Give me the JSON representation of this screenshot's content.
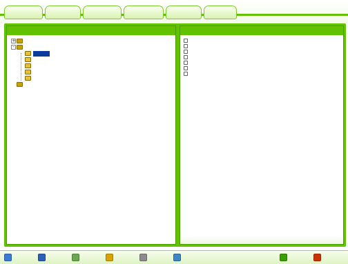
{
  "tabs": [
    {
      "label": ""
    },
    {
      "label": ""
    },
    {
      "label": ""
    },
    {
      "label": ""
    },
    {
      "label": ""
    },
    {
      "label": ""
    }
  ],
  "left_pane": {
    "title": "",
    "tree": [
      {
        "label": "",
        "level": 1,
        "expander": "+"
      },
      {
        "label": "",
        "level": 1,
        "expander": "-"
      },
      {
        "label": "",
        "level": 2,
        "selected": true
      },
      {
        "label": "",
        "level": 2
      },
      {
        "label": "",
        "level": 2
      },
      {
        "label": "",
        "level": 2
      },
      {
        "label": "",
        "level": 2
      },
      {
        "label": "",
        "level": 1
      }
    ]
  },
  "right_pane": {
    "title": "",
    "items": [
      {
        "label": "",
        "checked": false
      },
      {
        "label": "",
        "checked": false
      },
      {
        "label": "",
        "checked": false
      },
      {
        "label": "",
        "checked": false
      },
      {
        "label": "",
        "checked": false
      },
      {
        "label": "",
        "checked": false
      },
      {
        "label": "",
        "checked": false
      }
    ]
  },
  "toolbar": {
    "buttons": [
      {
        "label": "",
        "icon": "refresh-icon",
        "color": "#3a7bd5"
      },
      {
        "label": "",
        "icon": "search-icon",
        "color": "#2b5fb8"
      },
      {
        "label": "",
        "icon": "edit-icon",
        "color": "#6aa84f"
      },
      {
        "label": "",
        "icon": "folder-icon",
        "color": "#d9a400"
      },
      {
        "label": "",
        "icon": "print-icon",
        "color": "#8c8c8c"
      },
      {
        "label": "",
        "icon": "tools-icon",
        "color": "#3d85c6"
      }
    ],
    "right_buttons": [
      {
        "label": "",
        "icon": "next-icon",
        "color": "#38a000"
      },
      {
        "label": "",
        "icon": "exit-icon",
        "color": "#cc3300"
      }
    ]
  },
  "colors": {
    "frame_green": "#62c200",
    "selection_blue": "#0a3c9c",
    "tab_text": "#2e6b00"
  }
}
